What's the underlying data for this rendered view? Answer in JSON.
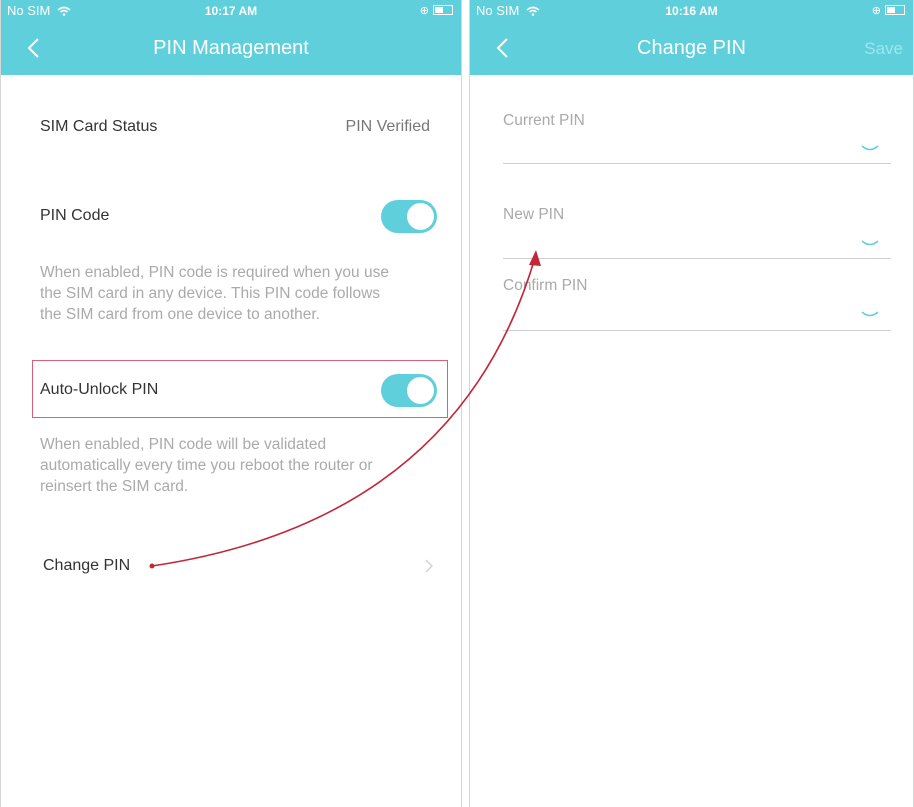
{
  "left_screen": {
    "status": {
      "carrier": "No SIM",
      "time": "10:17 AM"
    },
    "title": "PIN Management",
    "sim_status": {
      "label": "SIM Card Status",
      "value": "PIN Verified"
    },
    "pin_code": {
      "label": "PIN Code",
      "enabled": true,
      "description_lines": [
        "When enabled, PIN code is required when you use",
        "the SIM card in any device. This PIN code follows",
        "the SIM card from one device to another."
      ]
    },
    "auto_unlock": {
      "label": "Auto-Unlock PIN",
      "enabled": true,
      "description_lines": [
        "When enabled, PIN code will be validated",
        "automatically every time you reboot the router or",
        "reinsert the SIM card."
      ]
    },
    "change_pin": {
      "label": "Change PIN"
    }
  },
  "right_screen": {
    "status": {
      "carrier": "No SIM",
      "time": "10:16 AM"
    },
    "title": "Change PIN",
    "save_label": "Save",
    "fields": [
      {
        "label": "Current PIN"
      },
      {
        "label": "New PIN"
      },
      {
        "label": "Confirm PIN"
      }
    ]
  },
  "colors": {
    "accent": "#5fcfdb",
    "highlight": "#d9607a",
    "arrow": "#c0283a"
  },
  "icons": {
    "back": "chevron-left-icon",
    "row_arrow": "chevron-right-icon",
    "password_visibility": "eye-closed-icon",
    "wifi": "wifi-icon",
    "battery": "battery-icon"
  }
}
